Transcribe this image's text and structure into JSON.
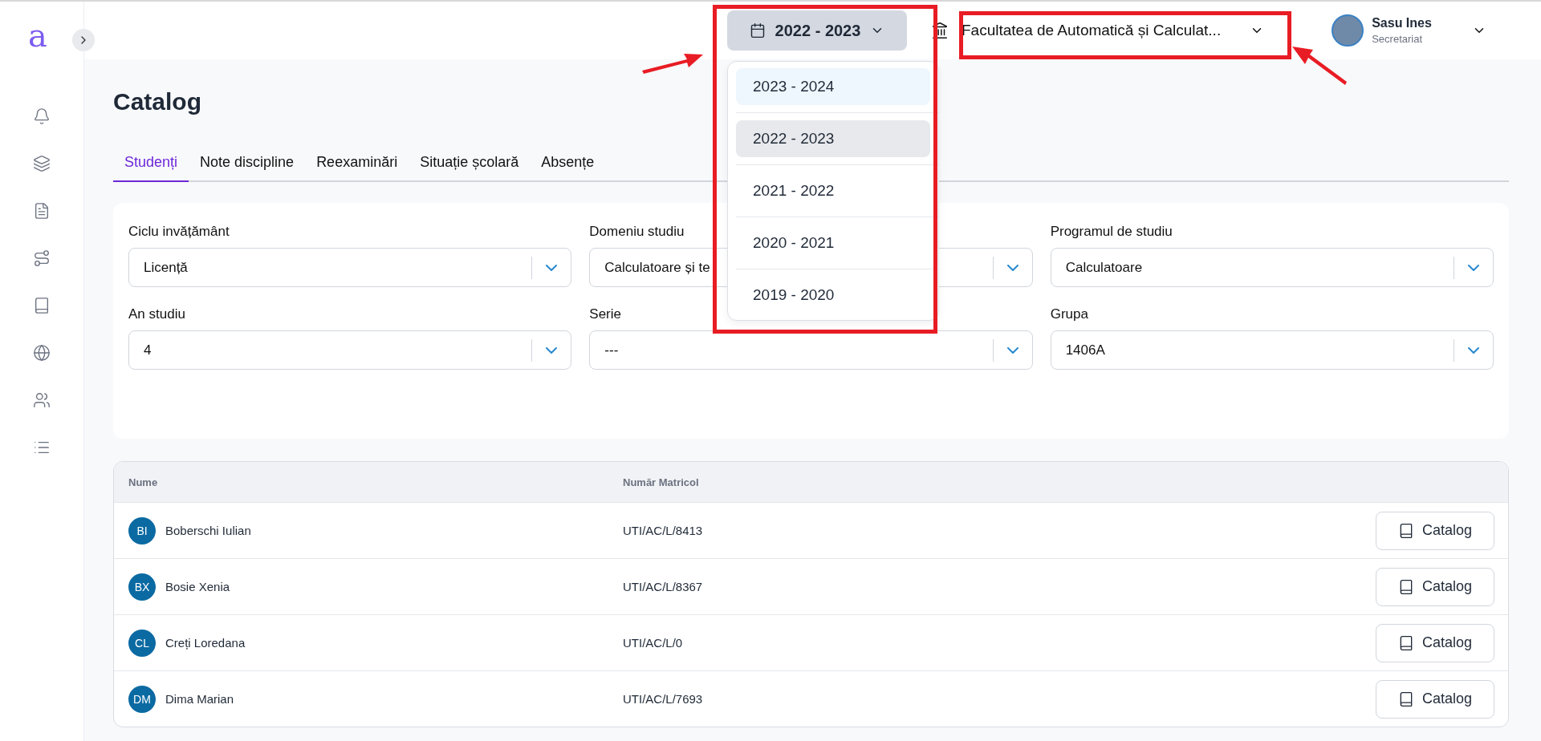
{
  "sidebar": {
    "logo": "a"
  },
  "header": {
    "year_picker": {
      "value": "2022 - 2023",
      "expanded": true,
      "options": [
        {
          "label": "2023 - 2024",
          "selected": false,
          "highlighted": true
        },
        {
          "label": "2022 - 2023",
          "selected": true,
          "highlighted": false
        },
        {
          "label": "2021 - 2022",
          "selected": false,
          "highlighted": false
        },
        {
          "label": "2020 - 2021",
          "selected": false,
          "highlighted": false
        },
        {
          "label": "2019 - 2020",
          "selected": false,
          "highlighted": false
        }
      ]
    },
    "institution": {
      "value": "Facultatea de Automatică și Calculat..."
    },
    "user": {
      "name": "Sasu Ines",
      "role": "Secretariat"
    }
  },
  "page_title": "Catalog",
  "tabs": [
    {
      "label": "Studenți",
      "selected": true
    },
    {
      "label": "Note discipline",
      "selected": false
    },
    {
      "label": "Reexaminări",
      "selected": false
    },
    {
      "label": "Situație școlară",
      "selected": false
    },
    {
      "label": "Absențe",
      "selected": false
    }
  ],
  "filters": [
    {
      "label": "Ciclu invățământ",
      "value": "Licență"
    },
    {
      "label": "Domeniu studiu",
      "value": "Calculatoare și te"
    },
    {
      "label": "Programul de studiu",
      "value": "Calculatoare"
    },
    {
      "label": "An studiu",
      "value": "4"
    },
    {
      "label": "Serie",
      "value": "---"
    },
    {
      "label": "Grupa",
      "value": "1406A"
    }
  ],
  "table": {
    "columns": [
      "Nume",
      "Număr Matricol"
    ],
    "rows": [
      {
        "initials": "BI",
        "name": "Boberschi Iulian",
        "number": "UTI/AC/L/8413",
        "action": "Catalog"
      },
      {
        "initials": "BX",
        "name": "Bosie Xenia",
        "number": "UTI/AC/L/8367",
        "action": "Catalog"
      },
      {
        "initials": "CL",
        "name": "Creți Loredana",
        "number": "UTI/AC/L/0",
        "action": "Catalog"
      },
      {
        "initials": "DM",
        "name": "Dima Marian",
        "number": "UTI/AC/L/7693",
        "action": "Catalog"
      }
    ]
  }
}
